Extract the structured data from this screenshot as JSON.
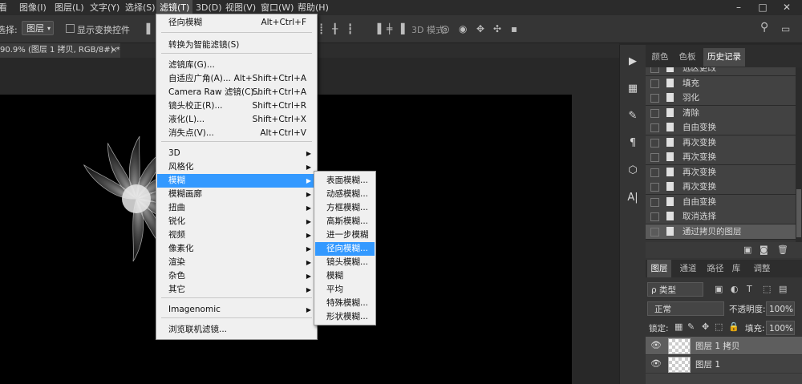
{
  "menubar": {
    "items": [
      "看",
      "图像(I)",
      "图层(L)",
      "文字(Y)",
      "选择(S)",
      "滤镜(T)",
      "3D(D)",
      "视图(V)",
      "窗口(W)",
      "帮助(H)"
    ],
    "window_buttons": [
      "–",
      "□",
      "✕"
    ]
  },
  "options_bar": {
    "select_label": "选择:",
    "select_value": "图层",
    "show_transform": "显示变换控件",
    "mode_3d": "3D 模式:"
  },
  "document_tab": {
    "title": "90.9% (图层 1 拷贝, RGB/8#) *",
    "close": "×"
  },
  "filter_menu": {
    "items": [
      {
        "label": "径向模糊",
        "shortcut": "Alt+Ctrl+F"
      },
      {
        "label": "转换为智能滤镜(S)",
        "shortcut": ""
      },
      {
        "label": "滤镜库(G)...",
        "shortcut": ""
      },
      {
        "label": "自适应广角(A)...",
        "shortcut": "Alt+Shift+Ctrl+A"
      },
      {
        "label": "Camera Raw 滤镜(C)...",
        "shortcut": "Shift+Ctrl+A"
      },
      {
        "label": "镜头校正(R)...",
        "shortcut": "Shift+Ctrl+R"
      },
      {
        "label": "液化(L)...",
        "shortcut": "Shift+Ctrl+X"
      },
      {
        "label": "消失点(V)...",
        "shortcut": "Alt+Ctrl+V"
      },
      {
        "label": "3D",
        "shortcut": ""
      },
      {
        "label": "风格化",
        "shortcut": ""
      },
      {
        "label": "模糊",
        "shortcut": ""
      },
      {
        "label": "模糊画廊",
        "shortcut": ""
      },
      {
        "label": "扭曲",
        "shortcut": ""
      },
      {
        "label": "锐化",
        "shortcut": ""
      },
      {
        "label": "视频",
        "shortcut": ""
      },
      {
        "label": "像素化",
        "shortcut": ""
      },
      {
        "label": "渲染",
        "shortcut": ""
      },
      {
        "label": "杂色",
        "shortcut": ""
      },
      {
        "label": "其它",
        "shortcut": ""
      },
      {
        "label": "Imagenomic",
        "shortcut": ""
      },
      {
        "label": "浏览联机滤镜...",
        "shortcut": ""
      }
    ],
    "highlighted": "模糊"
  },
  "blur_submenu": {
    "items": [
      "表面模糊...",
      "动感模糊...",
      "方框模糊...",
      "高斯模糊...",
      "进一步模糊",
      "径向模糊...",
      "镜头模糊...",
      "模糊",
      "平均",
      "特殊模糊...",
      "形状模糊..."
    ],
    "highlighted": "径向模糊..."
  },
  "panel_tabs": [
    "颜色",
    "色板",
    "历史记录"
  ],
  "history": [
    "选区更改",
    "填充",
    "羽化",
    "清除",
    "自由变换",
    "再次变换",
    "再次变换",
    "再次变换",
    "再次变换",
    "自由变换",
    "取消选择",
    "通过拷贝的图层"
  ],
  "layers_tabs": [
    "图层",
    "通道",
    "路径",
    "库",
    "调整"
  ],
  "layers": {
    "filter_kind": "ρ 类型",
    "blend_mode": "正常",
    "opacity_label": "不透明度:",
    "opacity_value": "100%",
    "lock_label": "锁定:",
    "fill_label": "填充:",
    "fill_value": "100%",
    "items": [
      "图层 1 拷贝",
      "图层 1"
    ]
  },
  "colors": {
    "accent": "#3399ff",
    "menu_bg": "#f0f0f0",
    "app_bg": "#282828",
    "panel_bg": "#353535"
  }
}
